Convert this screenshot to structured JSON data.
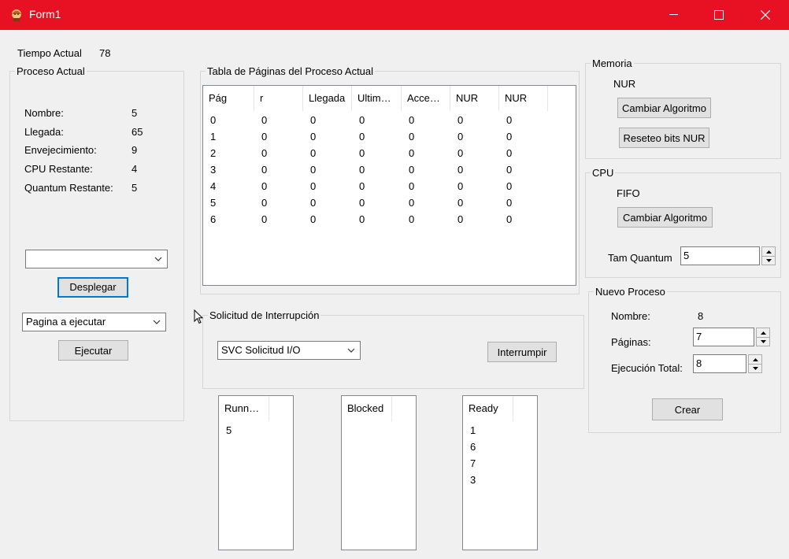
{
  "window": {
    "title": "Form1"
  },
  "clock": {
    "label": "Tiempo Actual",
    "value": "78"
  },
  "current_process": {
    "title": "Proceso Actual",
    "fields": [
      {
        "label": "Nombre:",
        "value": "5"
      },
      {
        "label": "Llegada:",
        "value": "65"
      },
      {
        "label": "Envejecimiento:",
        "value": "9"
      },
      {
        "label": "CPU Restante:",
        "value": "4"
      },
      {
        "label": "Quantum Restante:",
        "value": "5"
      }
    ],
    "dropdown_value": "",
    "deploy_label": "Desplegar",
    "page_select_value": "Pagina a ejecutar",
    "execute_label": "Ejecutar"
  },
  "page_table": {
    "title": "Tabla de Páginas del Proceso Actual",
    "columns": [
      "Pág",
      "r",
      "Llegada",
      "Ultim…",
      "Acce…",
      "NUR",
      "NUR"
    ],
    "rows": [
      [
        "0",
        "0",
        "0",
        "0",
        "0",
        "0",
        "0"
      ],
      [
        "1",
        "0",
        "0",
        "0",
        "0",
        "0",
        "0"
      ],
      [
        "2",
        "0",
        "0",
        "0",
        "0",
        "0",
        "0"
      ],
      [
        "3",
        "0",
        "0",
        "0",
        "0",
        "0",
        "0"
      ],
      [
        "4",
        "0",
        "0",
        "0",
        "0",
        "0",
        "0"
      ],
      [
        "5",
        "0",
        "0",
        "0",
        "0",
        "0",
        "0"
      ],
      [
        "6",
        "0",
        "0",
        "0",
        "0",
        "0",
        "0"
      ]
    ]
  },
  "interrupt": {
    "title": "Solicitud de Interrupción",
    "select_value": "SVC Solicitud I/O",
    "button_label": "Interrumpir"
  },
  "queues": [
    {
      "header": "Runn…",
      "items": [
        "5"
      ]
    },
    {
      "header": "Blocked",
      "items": []
    },
    {
      "header": "Ready",
      "items": [
        "1",
        "6",
        "7",
        "3"
      ]
    }
  ],
  "memory": {
    "title": "Memoria",
    "algorithm": "NUR",
    "change_label": "Cambiar Algoritmo",
    "reset_label": "Reseteo bits NUR"
  },
  "cpu": {
    "title": "CPU",
    "algorithm": "FIFO",
    "change_label": "Cambiar Algoritmo",
    "quantum_label": "Tam Quantum",
    "quantum_value": "5"
  },
  "new_process": {
    "title": "Nuevo Proceso",
    "name_label": "Nombre:",
    "name_value": "8",
    "pages_label": "Páginas:",
    "pages_value": "7",
    "exec_label": "Ejecución Total:",
    "exec_value": "8",
    "create_label": "Crear"
  },
  "colors": {
    "titlebar": "#e81123",
    "focus": "#0078d7"
  }
}
